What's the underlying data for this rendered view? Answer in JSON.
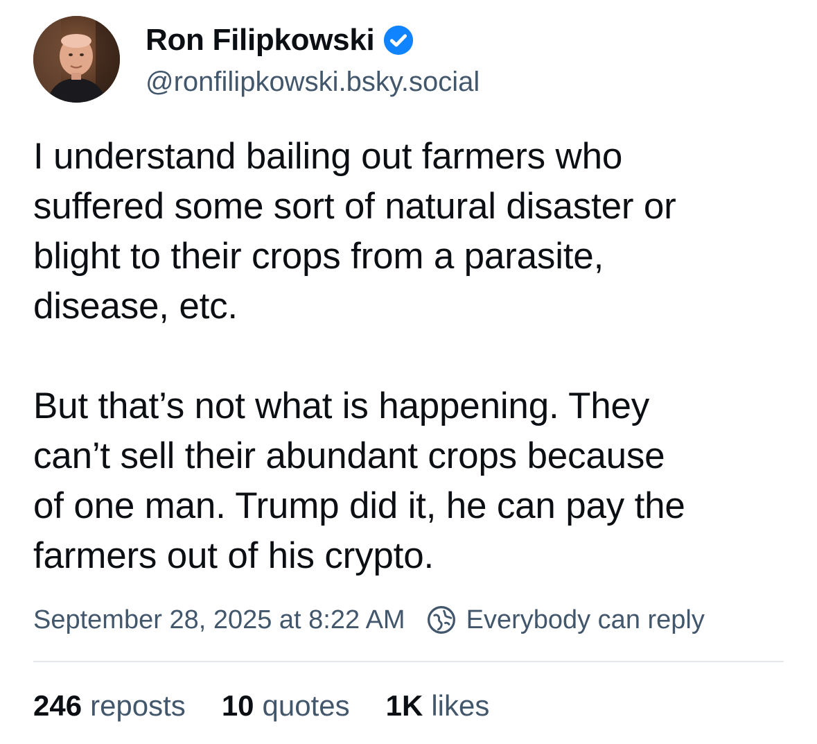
{
  "author": {
    "display_name": "Ron Filipkowski",
    "handle": "@ronfilipkowski.bsky.social",
    "verified": true,
    "verified_color": "#1083fe"
  },
  "post": {
    "paragraphs": [
      "I understand bailing out farmers who\nsuffered some sort of natural disaster or\nblight to their crops from a parasite,\ndisease, etc.",
      "But that’s not what is happening. They\ncan’t sell their abundant crops because\nof one man. Trump did it, he can pay the\nfarmers out of his crypto."
    ],
    "timestamp": "September 28, 2025 at 8:22 AM",
    "reply_setting": "Everybody can reply"
  },
  "stats": {
    "reposts_count": "246",
    "reposts_label": "reposts",
    "quotes_count": "10",
    "quotes_label": "quotes",
    "likes_count": "1K",
    "likes_label": "likes"
  },
  "icons": {
    "verified": "verified-check-icon",
    "reply_setting": "earth-reply-icon"
  },
  "colors": {
    "text_primary": "#0b0f14",
    "text_secondary": "#42576c",
    "divider": "#e4e8ec"
  }
}
